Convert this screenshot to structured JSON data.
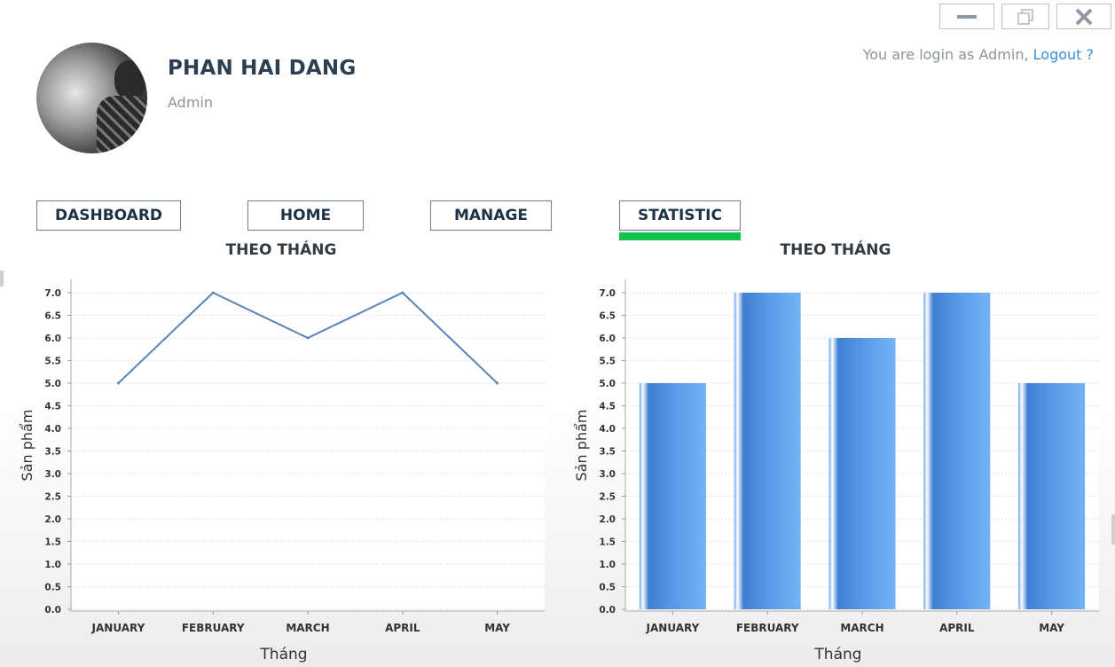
{
  "window": {
    "controls": [
      "minimize-icon",
      "restore-icon",
      "close-icon"
    ]
  },
  "profile": {
    "name": "PHAN HAI DANG",
    "role": "Admin"
  },
  "login": {
    "prefix": "You are login as Admin, ",
    "logout_label": "Logout ?"
  },
  "nav": {
    "dashboard": "DASHBOARD",
    "home": "HOME",
    "manage": "MANAGE",
    "statistic": "STATISTIC",
    "active": "STATISTIC",
    "active_color": "#12c251"
  },
  "colors": {
    "line": "#5b84b6",
    "bar": "#5b9be8"
  },
  "chart_data": [
    {
      "type": "line",
      "title": "THEO THÁNG",
      "xlabel": "Tháng",
      "ylabel": "Sản phẩm",
      "categories": [
        "JANUARY",
        "FEBRUARY",
        "MARCH",
        "APRIL",
        "MAY"
      ],
      "values": [
        5,
        7,
        6,
        7,
        5
      ],
      "ylim": [
        0,
        7
      ],
      "yticks": [
        "0.0",
        "0.5",
        "1.0",
        "1.5",
        "2.0",
        "2.5",
        "3.0",
        "3.5",
        "4.0",
        "4.5",
        "5.0",
        "5.5",
        "6.0",
        "6.5",
        "7.0"
      ],
      "grid": true
    },
    {
      "type": "bar",
      "title": "THEO THÁNG",
      "xlabel": "Tháng",
      "ylabel": "Sản phẩm",
      "categories": [
        "JANUARY",
        "FEBRUARY",
        "MARCH",
        "APRIL",
        "MAY"
      ],
      "values": [
        5,
        7,
        6,
        7,
        5
      ],
      "ylim": [
        0,
        7
      ],
      "yticks": [
        "0.0",
        "0.5",
        "1.0",
        "1.5",
        "2.0",
        "2.5",
        "3.0",
        "3.5",
        "4.0",
        "4.5",
        "5.0",
        "5.5",
        "6.0",
        "6.5",
        "7.0"
      ],
      "grid": true
    }
  ]
}
